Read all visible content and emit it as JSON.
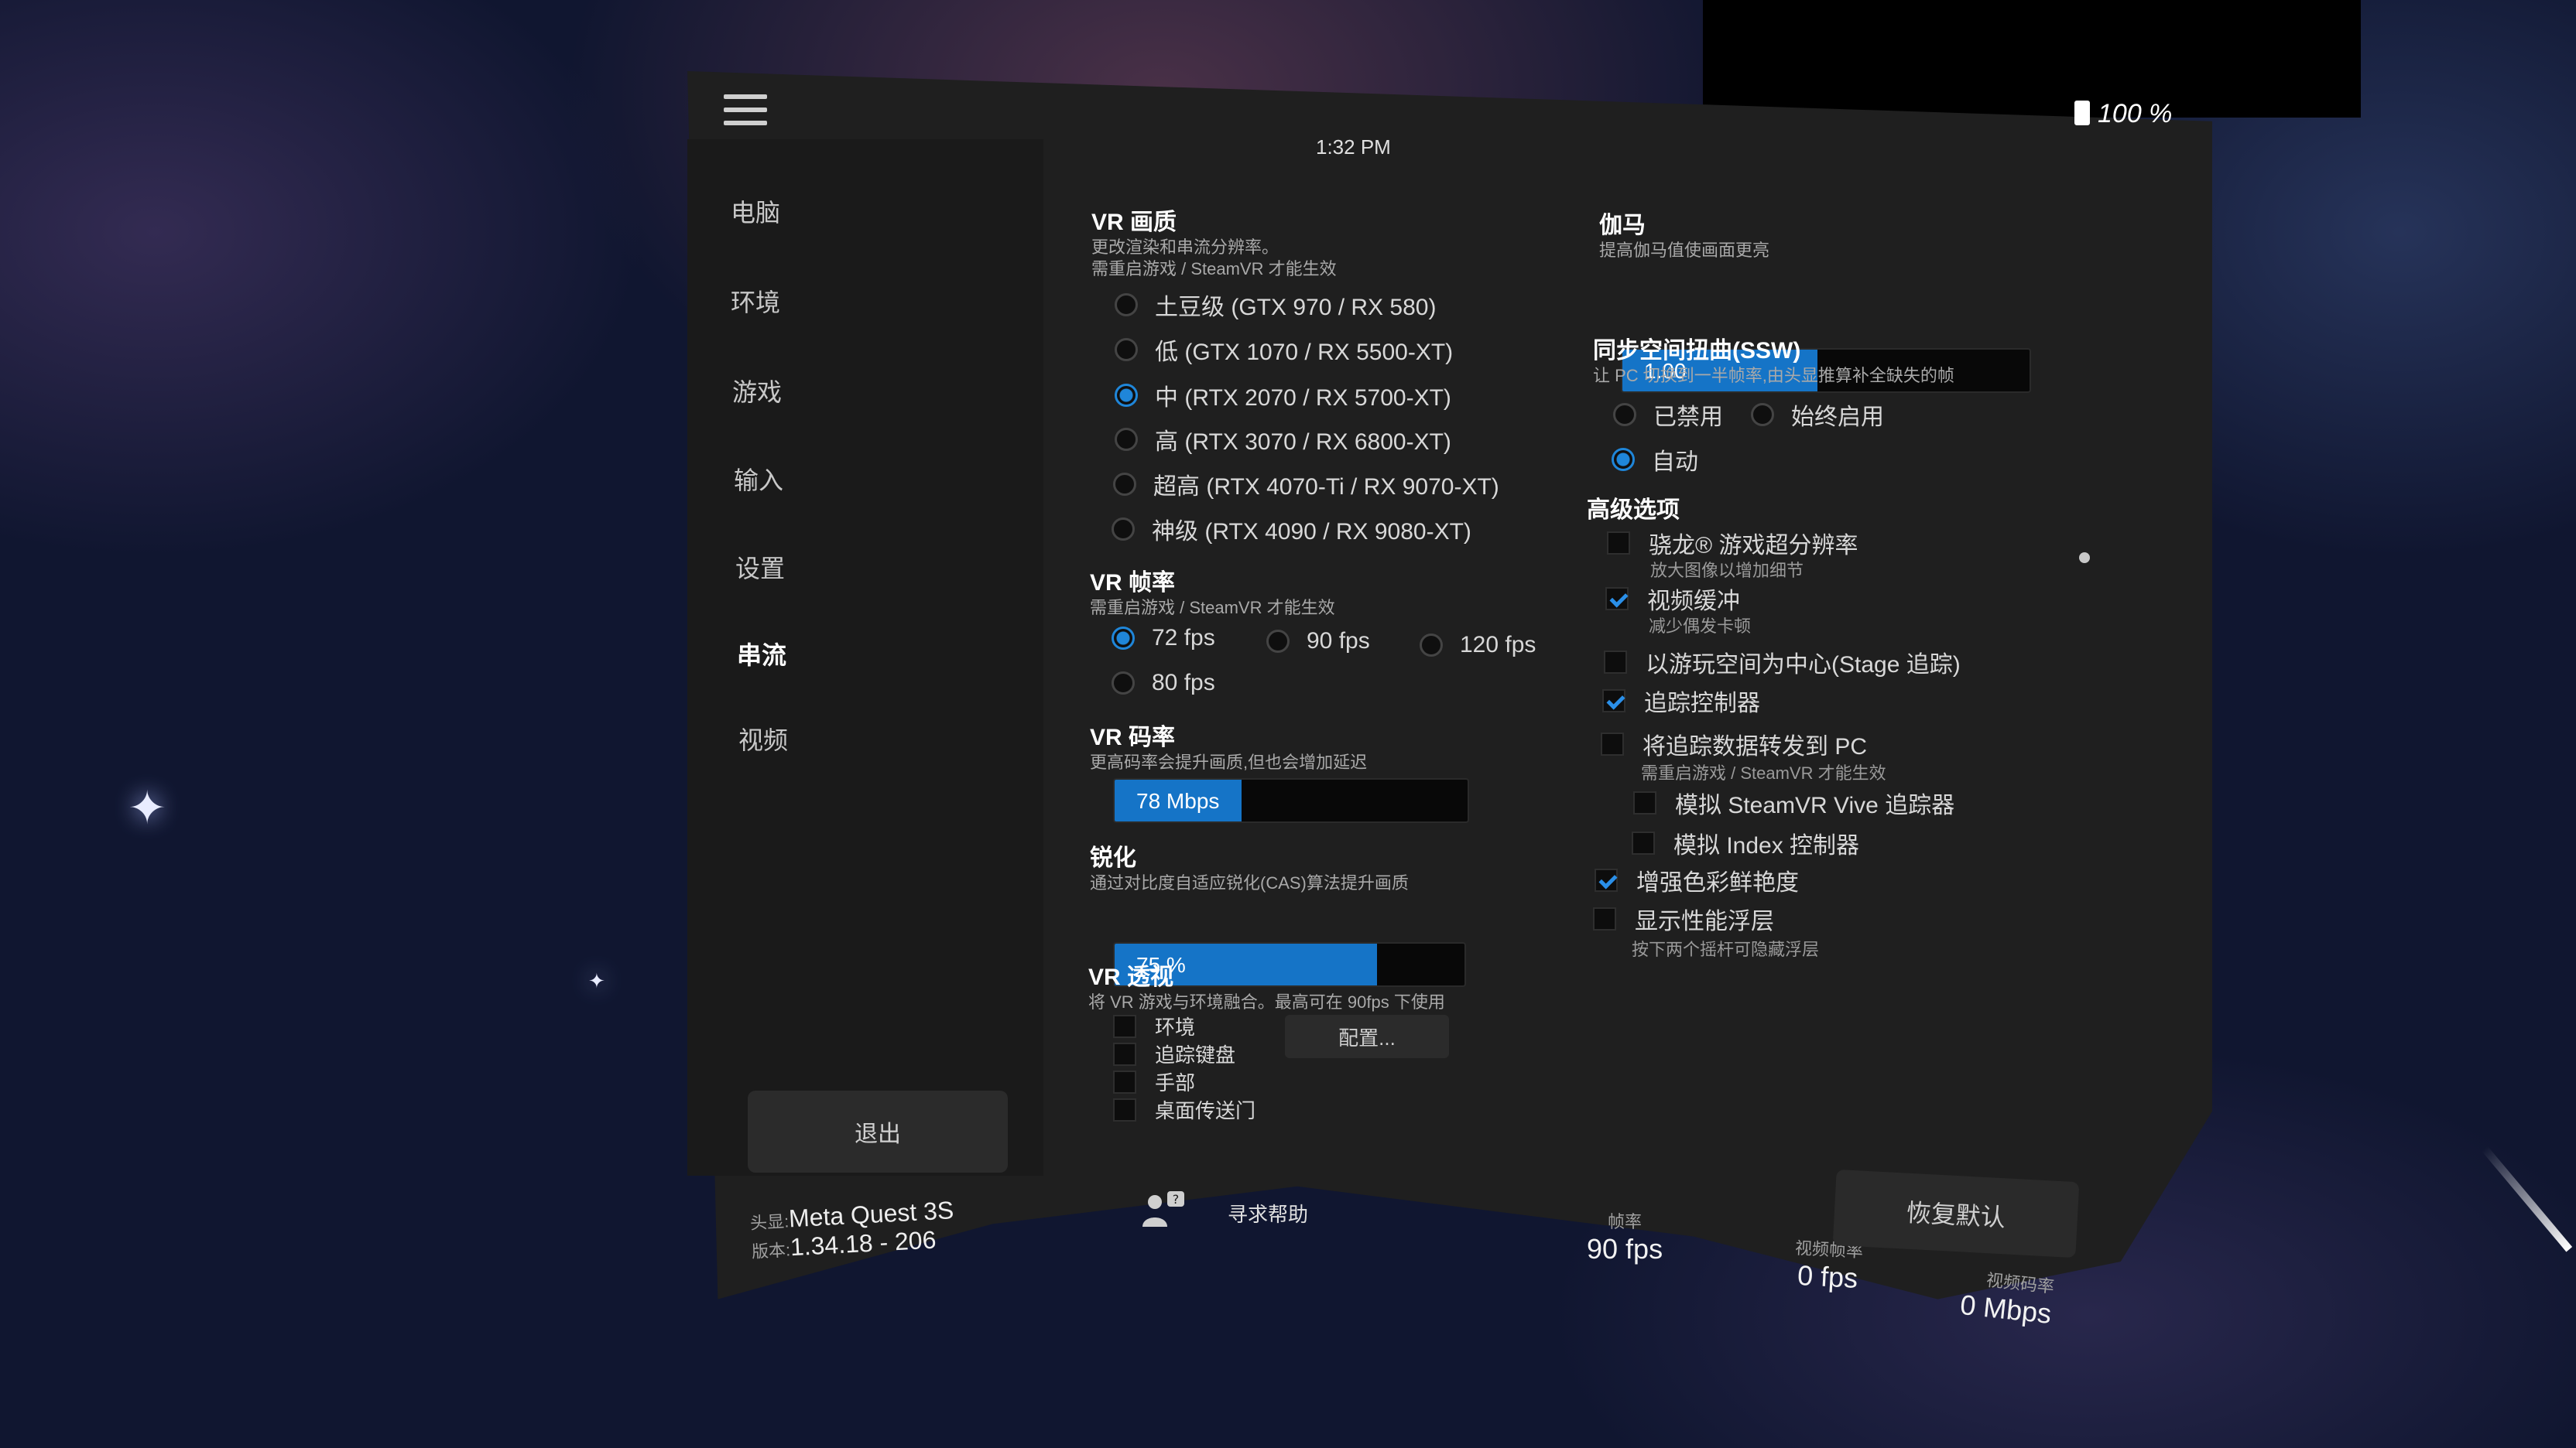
{
  "status": {
    "time": "1:32 PM",
    "battery": "100 %"
  },
  "sidebar": {
    "items": [
      {
        "label": "电脑"
      },
      {
        "label": "环境"
      },
      {
        "label": "游戏"
      },
      {
        "label": "输入"
      },
      {
        "label": "设置"
      },
      {
        "label": "串流",
        "active": true
      },
      {
        "label": "视频"
      }
    ],
    "exit_label": "退出"
  },
  "quality": {
    "title": "VR 画质",
    "desc1": "更改渲染和串流分辨率。",
    "desc2": "需重启游戏 / SteamVR 才能生效",
    "options": [
      {
        "label": "土豆级 (GTX 970 / RX 580)",
        "selected": false
      },
      {
        "label": "低 (GTX 1070 / RX 5500-XT)",
        "selected": false
      },
      {
        "label": "中 (RTX 2070 / RX 5700-XT)",
        "selected": true
      },
      {
        "label": "高 (RTX 3070 / RX 6800-XT)",
        "selected": false
      },
      {
        "label": "超高 (RTX 4070-Ti / RX 9070-XT)",
        "selected": false
      },
      {
        "label": "神级 (RTX 4090 / RX 9080-XT)",
        "selected": false
      }
    ]
  },
  "framerate": {
    "title": "VR 帧率",
    "desc": "需重启游戏 / SteamVR 才能生效",
    "options": [
      {
        "label": "72 fps",
        "selected": true
      },
      {
        "label": "90 fps",
        "selected": false
      },
      {
        "label": "120 fps",
        "selected": false
      },
      {
        "label": "80 fps",
        "selected": false
      }
    ]
  },
  "bitrate": {
    "title": "VR 码率",
    "desc": "更高码率会提升画质,但也会增加延迟",
    "value": "78 Mbps",
    "fill_fraction": 0.36
  },
  "sharpen": {
    "title": "锐化",
    "desc": "通过对比度自适应锐化(CAS)算法提升画质",
    "value": "75 %",
    "fill_fraction": 0.75
  },
  "passthrough": {
    "title": "VR 透视",
    "desc": "将 VR 游戏与环境融合。最高可在 90fps 下使用",
    "options": [
      {
        "label": "环境",
        "checked": false
      },
      {
        "label": "追踪键盘",
        "checked": false
      },
      {
        "label": "手部",
        "checked": false
      },
      {
        "label": "桌面传送门",
        "checked": false
      }
    ],
    "config_label": "配置..."
  },
  "gamma": {
    "title": "伽马",
    "desc": "提高伽马值使画面更亮",
    "value": "1.00",
    "fill_fraction": 0.48
  },
  "ssw": {
    "title": "同步空间扭曲(SSW)",
    "desc": "让 PC 切换到一半帧率,由头显推算补全缺失的帧",
    "options": [
      {
        "label": "已禁用",
        "selected": false
      },
      {
        "label": "始终启用",
        "selected": false
      },
      {
        "label": "自动",
        "selected": true
      }
    ]
  },
  "advanced": {
    "title": "高级选项",
    "options": [
      {
        "label": "骁龙® 游戏超分辨率",
        "sub": "放大图像以增加细节",
        "checked": false
      },
      {
        "label": "视频缓冲",
        "sub": "减少偶发卡顿",
        "checked": true
      },
      {
        "label": "以游玩空间为中心(Stage 追踪)",
        "sub": "",
        "checked": false
      },
      {
        "label": "追踪控制器",
        "sub": "",
        "checked": true
      },
      {
        "label": "将追踪数据转发到 PC",
        "sub": "需重启游戏 / SteamVR 才能生效",
        "checked": false
      },
      {
        "label": "模拟 SteamVR Vive 追踪器",
        "sub": "",
        "checked": false
      },
      {
        "label": "模拟 Index 控制器",
        "sub": "",
        "checked": false
      },
      {
        "label": "增强色彩鲜艳度",
        "sub": "",
        "checked": true
      },
      {
        "label": "显示性能浮层",
        "sub": "按下两个摇杆可隐藏浮层",
        "checked": false
      }
    ]
  },
  "footer": {
    "headset_label": "头显:",
    "headset_value": "Meta Quest 3S",
    "version_label": "版本:",
    "version_value": "1.34.18 - 206",
    "help_label": "寻求帮助",
    "reset_label": "恢复默认",
    "fps_label": "帧率",
    "fps_value": "90 fps",
    "video_fps_label": "视频帧率",
    "video_fps_value": "0 fps",
    "video_bitrate_label": "视频码率",
    "video_bitrate_value": "0 Mbps"
  },
  "colors": {
    "accent": "#1f86d9",
    "panel": "#1f1f1f",
    "sidebar": "#1a1a1a"
  },
  "icons": {
    "menu": "hamburger-icon",
    "battery": "battery-icon",
    "help": "help-person-icon"
  }
}
